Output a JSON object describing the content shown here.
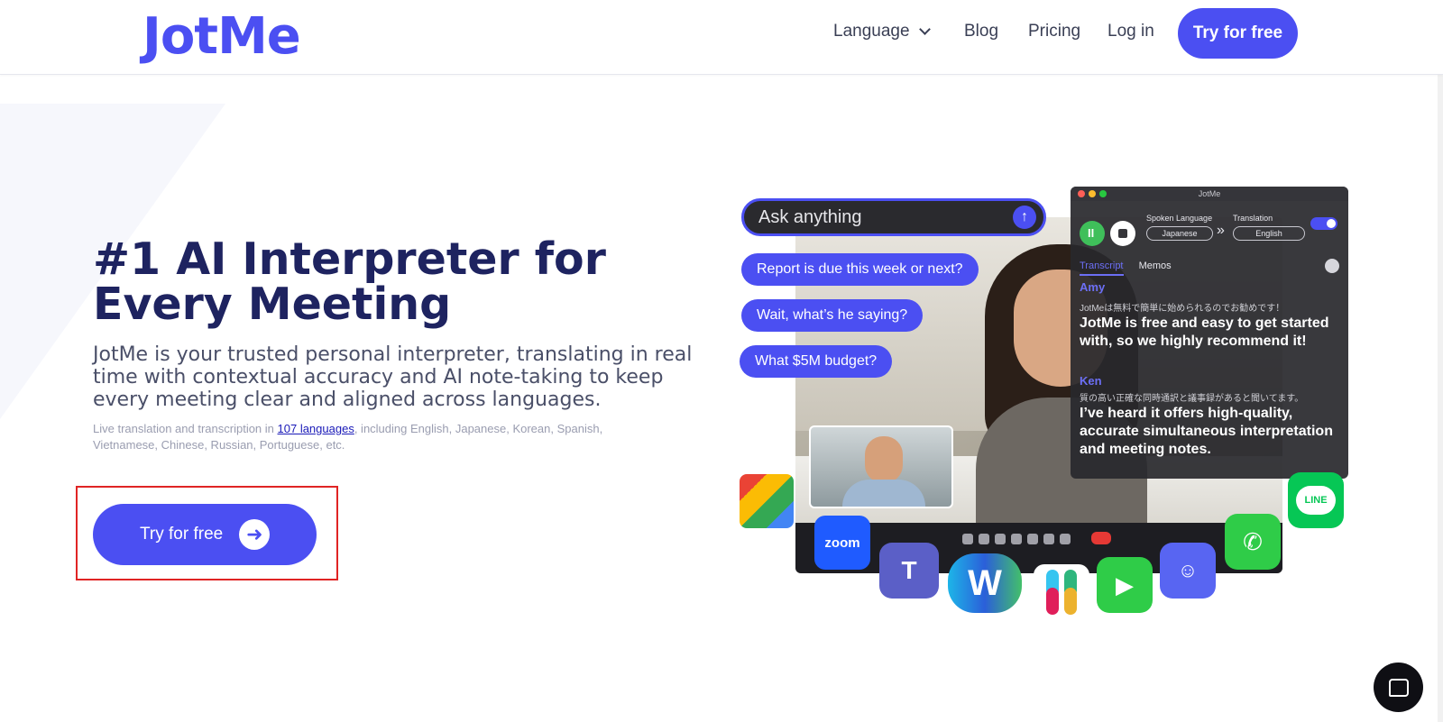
{
  "brand": {
    "name": "JotMe",
    "accent": "#4b4ff2"
  },
  "nav": {
    "language_label": "Language",
    "blog_label": "Blog",
    "pricing_label": "Pricing",
    "login_label": "Log in",
    "cta_label": "Try for free"
  },
  "hero": {
    "title": "#1 AI Interpreter for Every Meeting",
    "subtitle": "JotMe is your trusted personal interpreter, translating in real time with contextual accuracy and AI note-taking to keep every meeting clear and aligned across languages.",
    "small_prefix": "Live translation and transcription in ",
    "small_link": "107 languages",
    "small_suffix": ", including English, Japanese, Korean, Spanish, Vietnamese, Chinese, Russian, Portuguese, etc.",
    "cta_label": "Try for free"
  },
  "illustration": {
    "ask_placeholder": "Ask anything",
    "chips": [
      "Report is due this week or next?",
      "Wait, what’s he saying?",
      "What $5M budget?"
    ],
    "panel": {
      "window_title": "JotMe",
      "spoken_language_label": "Spoken Language",
      "spoken_language_value": "Japanese",
      "translation_label": "Translation",
      "translation_toggle": "ON",
      "translation_value": "English",
      "tab_transcript": "Transcript",
      "tab_memos": "Memos",
      "speaker1": "Amy",
      "speaker1_jp": "JotMeは無料で簡単に始められるのでお勧めです！",
      "speaker1_en": "JotMe is free and easy to get started with, so we highly recommend it!",
      "speaker2": "Ken",
      "speaker2_jp": "質の高い正確な同時通訳と議事録があると聞いてます。",
      "speaker2_en": "I’ve heard it offers high-quality, accurate simultaneous interpretation and meeting notes."
    },
    "app_icons": {
      "zoom": "zoom",
      "line": "LINE"
    }
  }
}
